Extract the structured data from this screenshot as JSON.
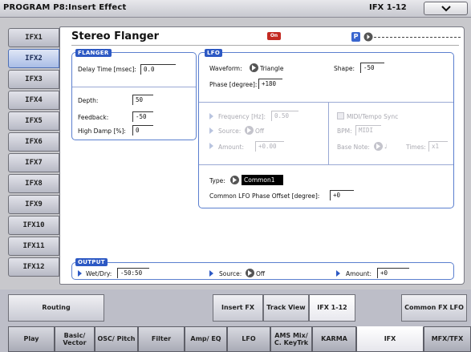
{
  "header": {
    "title": "PROGRAM P8:Insert Effect",
    "range": "IFX 1-12"
  },
  "side_tabs": [
    "IFX1",
    "IFX2",
    "IFX3",
    "IFX4",
    "IFX5",
    "IFX6",
    "IFX7",
    "IFX8",
    "IFX9",
    "IFX10",
    "IFX11",
    "IFX12"
  ],
  "active_side_tab": "IFX2",
  "effect": {
    "name": "Stereo Flanger",
    "on_label": "On",
    "p_label": "P"
  },
  "flanger": {
    "label": "FLANGER",
    "delay_time_label": "Delay Time [msec]:",
    "delay_time_value": "0.0",
    "depth_label": "Depth:",
    "depth_value": "50",
    "feedback_label": "Feedback:",
    "feedback_value": "-50",
    "high_damp_label": "High Damp [%]:",
    "high_damp_value": "0"
  },
  "lfo": {
    "label": "LFO",
    "waveform_label": "Waveform:",
    "waveform_value": "Triangle",
    "shape_label": "Shape:",
    "shape_value": "-50",
    "phase_label": "Phase [degree]:",
    "phase_value": "+180",
    "frequency_label": "Frequency [Hz]:",
    "frequency_value": "0.50",
    "source_label": "Source:",
    "source_value": "Off",
    "amount_label": "Amount:",
    "amount_value": "+0.00",
    "midi_sync_label": "MIDI/Tempo Sync",
    "bpm_label": "BPM:",
    "bpm_value": "MIDI",
    "base_note_label": "Base Note:",
    "base_note_value": "♩",
    "times_label": "Times:",
    "times_value": "x1",
    "type_label": "Type:",
    "type_value": "Common1",
    "common_phase_label": "Common LFO Phase Offset [degree]:",
    "common_phase_value": "+0"
  },
  "output": {
    "label": "OUTPUT",
    "wet_dry_label": "Wet/Dry:",
    "wet_dry_value": "-50:50",
    "source_label": "Source:",
    "source_value": "Off",
    "amount_label": "Amount:",
    "amount_value": "+0"
  },
  "sub_tabs": [
    {
      "label": "Routing"
    },
    {
      "label": "Insert FX"
    },
    {
      "label": "Track View"
    },
    {
      "label": "IFX 1-12"
    },
    {
      "label": "Common FX LFO"
    }
  ],
  "active_sub_tab": "IFX 1-12",
  "global_tabs": [
    "Play",
    "Basic/ Vector",
    "OSC/ Pitch",
    "Filter",
    "Amp/ EQ",
    "LFO",
    "AMS Mix/ C. KeyTrk",
    "KARMA",
    "IFX",
    "MFX/TFX"
  ],
  "active_global_tab": "IFX",
  "colors": {
    "accent": "#2d59c4",
    "on_badge": "#c32a22"
  }
}
